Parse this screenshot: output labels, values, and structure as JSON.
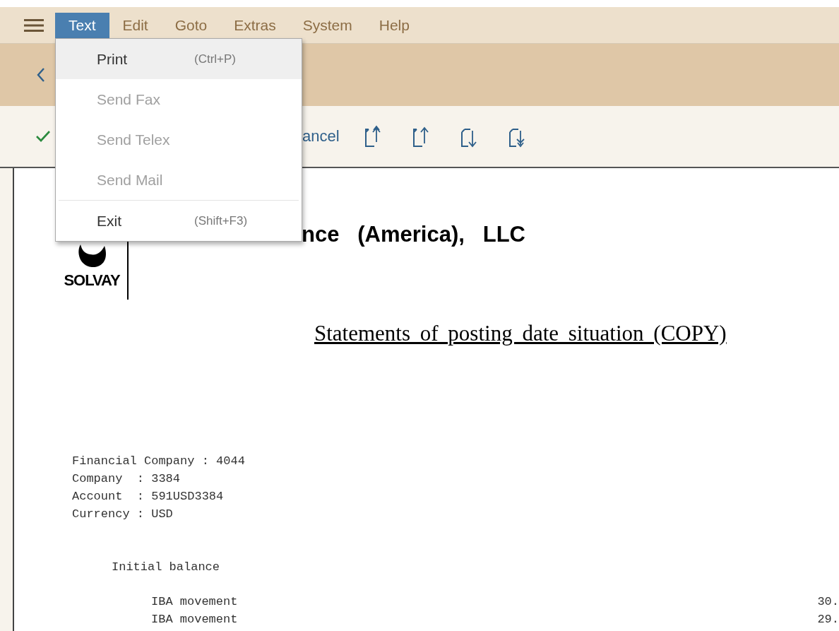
{
  "menu_bar": [
    {
      "label": "Text",
      "selected": true
    },
    {
      "label": "Edit",
      "selected": false
    },
    {
      "label": "Goto",
      "selected": false
    },
    {
      "label": "Extras",
      "selected": false
    },
    {
      "label": "System",
      "selected": false
    },
    {
      "label": "Help",
      "selected": false
    }
  ],
  "dropdown": [
    {
      "label": "Print",
      "shortcut": "(Ctrl+P)",
      "disabled": false,
      "highlighted": true,
      "separator_before": false
    },
    {
      "label": "Send Fax",
      "disabled": true,
      "highlighted": false,
      "separator_before": false
    },
    {
      "label": "Send Telex",
      "disabled": true,
      "highlighted": false,
      "separator_before": false
    },
    {
      "label": "Send Mail",
      "disabled": true,
      "highlighted": false,
      "separator_before": false
    },
    {
      "label": "Exit",
      "shortcut": "(Shift+F3)",
      "disabled": false,
      "highlighted": false,
      "separator_before": true
    }
  ],
  "toolbar": {
    "cancel": "ancel"
  },
  "document": {
    "logo_text": "SOLVAY",
    "company": "nce   (America),   LLC",
    "heading": "Statements of posting date situation (COPY)",
    "info_lines": [
      "Financial Company : 4044",
      "Company  : 3384",
      "Account  : 591USD3384",
      "Currency : USD"
    ],
    "initial_balance": "Initial balance",
    "movements": [
      {
        "label": "IBA movement",
        "amount": "30."
      },
      {
        "label": "IBA movement",
        "amount": "29."
      }
    ]
  }
}
